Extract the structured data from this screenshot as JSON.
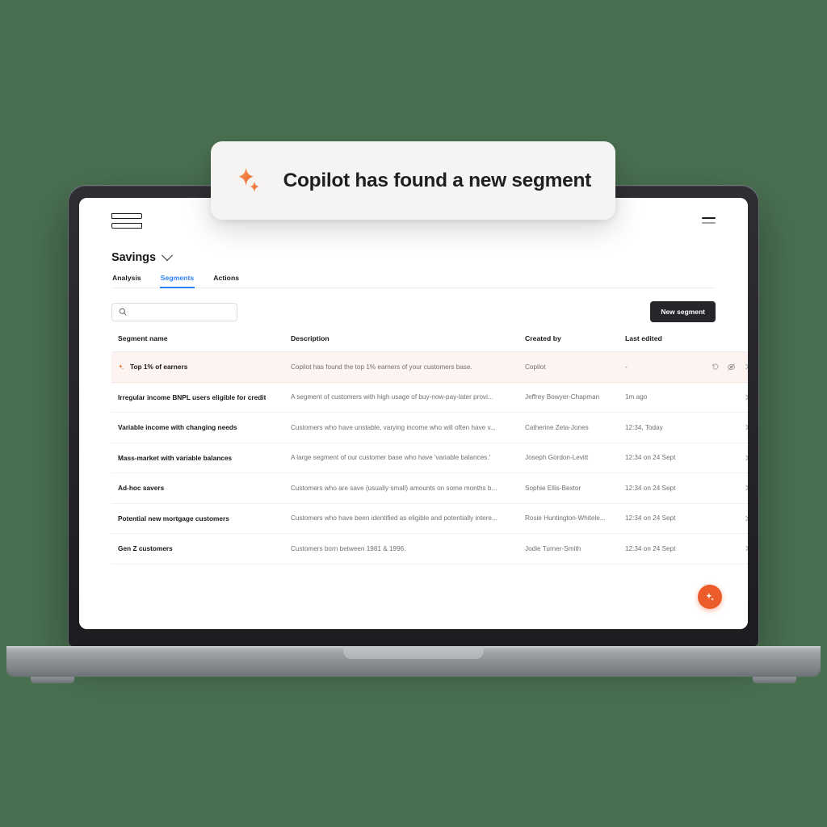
{
  "toast": {
    "icon": "sparkle-icon",
    "title": "Copilot has found a new segment"
  },
  "topbar": {
    "logo": "brand-logo",
    "menu_icon": "hamburger-menu-icon"
  },
  "page": {
    "title": "Savings",
    "title_chevron": "chevron-down-icon"
  },
  "tabs": [
    {
      "label": "Analysis",
      "active": false
    },
    {
      "label": "Segments",
      "active": true
    },
    {
      "label": "Actions",
      "active": false
    }
  ],
  "toolbar": {
    "search": {
      "icon": "search-icon",
      "value": "",
      "placeholder": ""
    },
    "new_segment_label": "New segment"
  },
  "table": {
    "columns": [
      "Segment name",
      "Description",
      "Created by",
      "Last edited",
      ""
    ],
    "rows": [
      {
        "name": "Top 1% of earners",
        "description": "Copilot has found the top 1% earners of your customers base.",
        "created_by": "Copilot",
        "last_edited": "-",
        "highlight": true,
        "has_sparkle": true,
        "actions": [
          "undo-icon",
          "eye-off-icon",
          "chevron-right-icon"
        ]
      },
      {
        "name": "Irregular income BNPL users eligible for credit",
        "description": "A segment of customers with high usage of buy-now-pay-later provi...",
        "created_by": "Jeffrey Bowyer-Chapman",
        "last_edited": "1m ago",
        "highlight": false,
        "has_sparkle": false,
        "actions": [
          "chevron-right-icon"
        ]
      },
      {
        "name": "Variable income with changing needs",
        "description": "Customers who have unstable, varying income who will often have v...",
        "created_by": "Catherine Zeta-Jones",
        "last_edited": "12:34, Today",
        "highlight": false,
        "has_sparkle": false,
        "actions": [
          "chevron-right-icon"
        ]
      },
      {
        "name": "Mass-market with variable balances",
        "description": "A large segment of our customer base who have 'variable balances.'",
        "created_by": "Joseph Gordon-Levitt",
        "last_edited": "12:34 on 24 Sept",
        "highlight": false,
        "has_sparkle": false,
        "actions": [
          "chevron-right-icon"
        ]
      },
      {
        "name": "Ad-hoc savers",
        "description": "Customers who are save (usually small) amounts on some months b...",
        "created_by": "Sophie Ellis-Bextor",
        "last_edited": "12:34 on 24 Sept",
        "highlight": false,
        "has_sparkle": false,
        "actions": [
          "chevron-right-icon"
        ]
      },
      {
        "name": "Potential new mortgage customers",
        "description": "Customers who have been identified as eligible and potentially intere...",
        "created_by": "Rosie Huntington-Whitele...",
        "last_edited": "12:34 on 24 Sept",
        "highlight": false,
        "has_sparkle": false,
        "actions": [
          "chevron-right-icon"
        ]
      },
      {
        "name": "Gen Z customers",
        "description": "Customers born between 1981 & 1996.",
        "created_by": "Jodie Turner-Smith",
        "last_edited": "12:34 on 24 Sept",
        "highlight": false,
        "has_sparkle": false,
        "actions": [
          "chevron-right-icon"
        ]
      }
    ]
  },
  "fab": {
    "icon": "sparkle-icon"
  },
  "colors": {
    "background": "#4a7051",
    "accent_orange": "#ec5c2b",
    "tab_active_blue": "#2d7ff9",
    "button_dark": "#24262a",
    "row_highlight": "#fdf3f0",
    "toast_bg": "#f5f4f2"
  }
}
